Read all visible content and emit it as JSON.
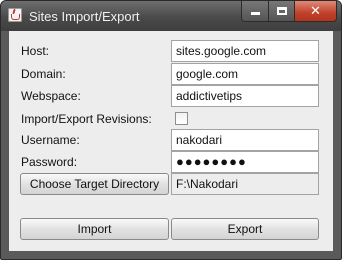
{
  "window": {
    "title": "Sites Import/Export"
  },
  "form": {
    "host_label": "Host:",
    "host_value": "sites.google.com",
    "domain_label": "Domain:",
    "domain_value": "google.com",
    "webspace_label": "Webspace:",
    "webspace_value": "addictivetips",
    "revisions_label": "Import/Export Revisions:",
    "revisions_checked": false,
    "username_label": "Username:",
    "username_value": "nakodari",
    "password_label": "Password:",
    "password_value": "●●●●●●●●",
    "choose_dir_label": "Choose Target Directory",
    "target_dir_value": "F:\\Nakodari"
  },
  "buttons": {
    "import_label": "Import",
    "export_label": "Export"
  }
}
